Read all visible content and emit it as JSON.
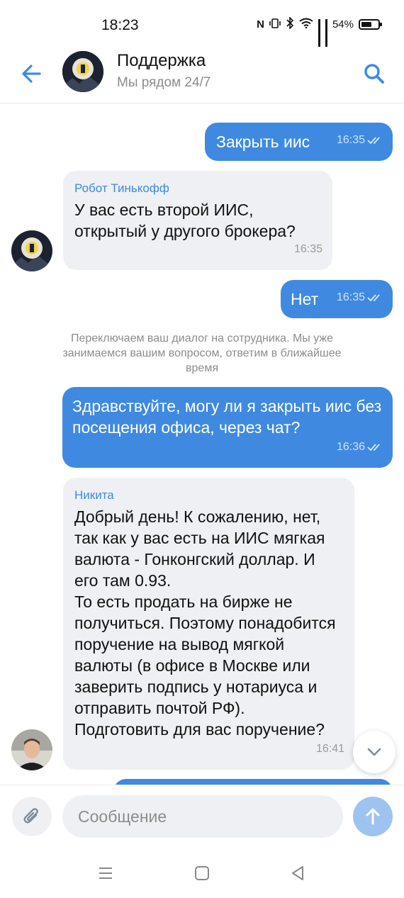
{
  "status_bar": {
    "time": "18:23",
    "battery": "54%"
  },
  "header": {
    "title": "Поддержка",
    "subtitle": "Мы рядом 24/7"
  },
  "messages": [
    {
      "type": "outgoing",
      "text": "Закрыть иис",
      "time": "16:35"
    },
    {
      "type": "incoming",
      "sender": "Робот Тинькофф",
      "text": "У вас есть второй ИИС, открытый у другого брокера?",
      "time": "16:35"
    },
    {
      "type": "outgoing",
      "text": "Нет",
      "time": "16:35"
    },
    {
      "type": "system",
      "text": "Переключаем ваш диалог на сотрудника. Мы уже занимаемся вашим вопросом, ответим в ближайшее время"
    },
    {
      "type": "outgoing",
      "text": "Здравствуйте, могу ли я закрыть иис без посещения офиса, через чат?",
      "time": "16:36"
    },
    {
      "type": "incoming",
      "sender": "Никита",
      "text": "Добрый день! К сожалению, нет, так как у вас есть на ИИС мягкая валюта - Гонконгский доллар. И его там 0.93.\nТо есть продать на бирже не получиться. Поэтому понадобится поручение на вывод мягкой валюты (в офисе в Москве или заверить подпись у нотариуса и отправить почтой РФ). Подготовить для вас поручение?",
      "time": "16:41"
    }
  ],
  "composer": {
    "placeholder": "Сообщение"
  },
  "colors": {
    "accent": "#3f8ae0",
    "incoming_bg": "#eef0f3"
  }
}
